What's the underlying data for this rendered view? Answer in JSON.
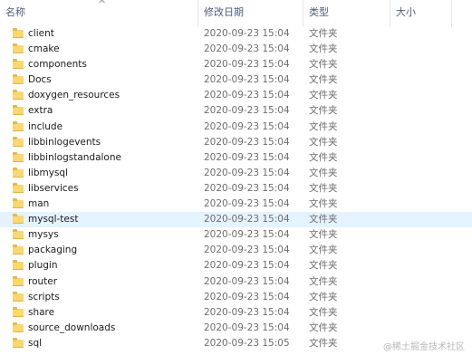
{
  "columns": {
    "name": "名称",
    "date": "修改日期",
    "type": "类型",
    "size": "大小",
    "sort_indicator": "^"
  },
  "rows": [
    {
      "name": "client",
      "date": "2020-09-23 15:04",
      "type": "文件夹"
    },
    {
      "name": "cmake",
      "date": "2020-09-23 15:04",
      "type": "文件夹"
    },
    {
      "name": "components",
      "date": "2020-09-23 15:04",
      "type": "文件夹"
    },
    {
      "name": "Docs",
      "date": "2020-09-23 15:04",
      "type": "文件夹"
    },
    {
      "name": "doxygen_resources",
      "date": "2020-09-23 15:04",
      "type": "文件夹"
    },
    {
      "name": "extra",
      "date": "2020-09-23 15:04",
      "type": "文件夹"
    },
    {
      "name": "include",
      "date": "2020-09-23 15:04",
      "type": "文件夹"
    },
    {
      "name": "libbinlogevents",
      "date": "2020-09-23 15:04",
      "type": "文件夹"
    },
    {
      "name": "libbinlogstandalone",
      "date": "2020-09-23 15:04",
      "type": "文件夹"
    },
    {
      "name": "libmysql",
      "date": "2020-09-23 15:04",
      "type": "文件夹"
    },
    {
      "name": "libservices",
      "date": "2020-09-23 15:04",
      "type": "文件夹"
    },
    {
      "name": "man",
      "date": "2020-09-23 15:04",
      "type": "文件夹"
    },
    {
      "name": "mysql-test",
      "date": "2020-09-23 15:04",
      "type": "文件夹",
      "selected": true
    },
    {
      "name": "mysys",
      "date": "2020-09-23 15:04",
      "type": "文件夹"
    },
    {
      "name": "packaging",
      "date": "2020-09-23 15:04",
      "type": "文件夹"
    },
    {
      "name": "plugin",
      "date": "2020-09-23 15:04",
      "type": "文件夹"
    },
    {
      "name": "router",
      "date": "2020-09-23 15:04",
      "type": "文件夹"
    },
    {
      "name": "scripts",
      "date": "2020-09-23 15:04",
      "type": "文件夹"
    },
    {
      "name": "share",
      "date": "2020-09-23 15:04",
      "type": "文件夹"
    },
    {
      "name": "source_downloads",
      "date": "2020-09-23 15:04",
      "type": "文件夹"
    },
    {
      "name": "sql",
      "date": "2020-09-23 15:05",
      "type": "文件夹"
    }
  ],
  "watermark": "@稀土掘金技术社区",
  "colors": {
    "folder": "#f8d775",
    "selected_row": "#e5f3ff",
    "header_text": "#4c607a"
  }
}
